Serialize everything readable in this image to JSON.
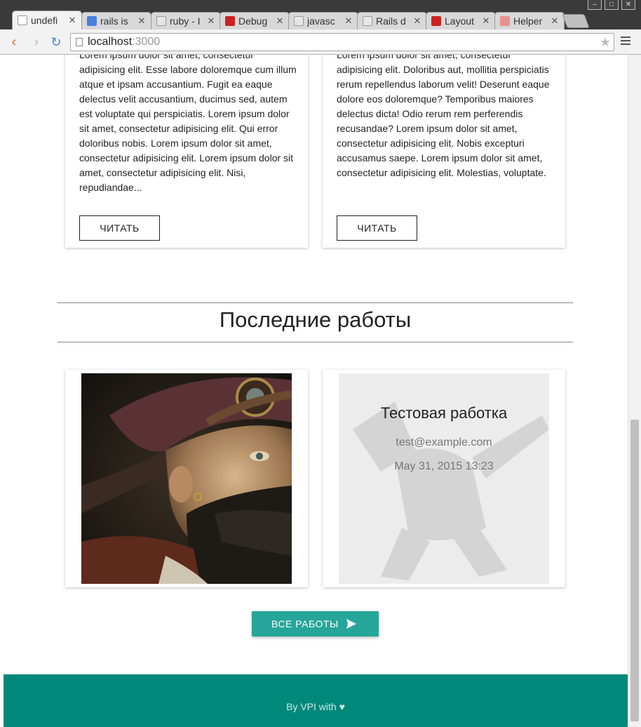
{
  "browser": {
    "tabs": [
      {
        "title": "undefi",
        "active": true,
        "favicon_color": "#ffffff"
      },
      {
        "title": "rails is",
        "favicon_color": "#4a7fe0"
      },
      {
        "title": "ruby - I",
        "favicon_color": "#e0e0e0"
      },
      {
        "title": "Debug",
        "favicon_color": "#cc2222"
      },
      {
        "title": "javasc",
        "favicon_color": "#e0e0e0"
      },
      {
        "title": "Rails d",
        "favicon_color": "#e0e0e0"
      },
      {
        "title": "Layout",
        "favicon_color": "#cc2222"
      },
      {
        "title": "Helper",
        "favicon_color": "#e89090"
      }
    ],
    "url_host": "localhost",
    "url_port": ":3000"
  },
  "posts": [
    {
      "excerpt": "Lorem ipsum dolor sit amet, consectetur adipisicing elit. Esse labore doloremque cum illum atque et ipsam accusantium. Fugit ea eaque delectus velit accusantium, ducimus sed, autem est voluptate qui perspiciatis. Lorem ipsum dolor sit amet, consectetur adipisicing elit. Qui error doloribus nobis. Lorem ipsum dolor sit amet, consectetur adipisicing elit. Lorem ipsum dolor sit amet, consectetur adipisicing elit. Nisi, repudiandae...",
      "read_label": "ЧИТАТЬ"
    },
    {
      "excerpt": "Lorem ipsum dolor sit amet, consectetur adipisicing elit. Doloribus aut, mollitia perspiciatis rerum repellendus laborum velit! Deserunt eaque dolore eos doloremque? Temporibus maiores delectus dicta! Odio rerum rem perferendis recusandae? Lorem ipsum dolor sit amet, consectetur adipisicing elit. Nobis excepturi accusamus saepe. Lorem ipsum dolor sit amet, consectetur adipisicing elit. Molestias, voluptate.",
      "read_label": "ЧИТАТЬ"
    }
  ],
  "works_section": {
    "title": "Последние работы",
    "works": [
      {
        "image": "bearded-pirate-portrait"
      },
      {
        "title": "Тестовая работка",
        "email": "test@example.com",
        "date": "May 31, 2015 13:23"
      }
    ],
    "all_works_label": "ВСЕ РАБОТЫ"
  },
  "footer": {
    "credit": "By VPI with ♥"
  },
  "colors": {
    "accent": "#26a69a",
    "footer": "#00897b"
  }
}
